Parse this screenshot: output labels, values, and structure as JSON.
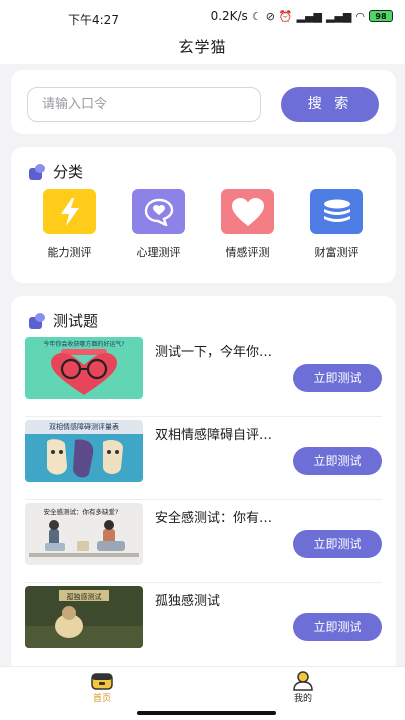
{
  "status_bar": {
    "time": "下午4:27",
    "speed": "0.2K/s",
    "battery": "98"
  },
  "app_title": "玄学猫",
  "search": {
    "placeholder": "请输入口令",
    "button_label": "搜 索"
  },
  "categories": {
    "title": "分类",
    "items": [
      {
        "label": "能力测评",
        "color": "#ffcc1a",
        "icon": "lightning-icon"
      },
      {
        "label": "心理测评",
        "color": "#8d82e8",
        "icon": "heart-bubble-icon"
      },
      {
        "label": "情感评测",
        "color": "#f47e86",
        "icon": "heart-icon"
      },
      {
        "label": "财富测评",
        "color": "#4f7de6",
        "icon": "coins-icon"
      }
    ]
  },
  "tests": {
    "title": "测试题",
    "button_label": "立即测试",
    "items": [
      {
        "title": "测试一下，今年你会收获哪方面的好运气？",
        "thumb_text": "今年你会收获哪方面的好运气?"
      },
      {
        "title": "双相情感障碍自评量表",
        "thumb_text": "双相情感障碍测评量表"
      },
      {
        "title": "安全感测试：你有多缺爱？",
        "thumb_text": "安全感测试：你有多缺爱?"
      },
      {
        "title": "孤独感测试",
        "thumb_text": "孤独感测试"
      }
    ]
  },
  "tab_bar": {
    "home_label": "首页",
    "me_label": "我的",
    "active_color": "#d4961f"
  }
}
